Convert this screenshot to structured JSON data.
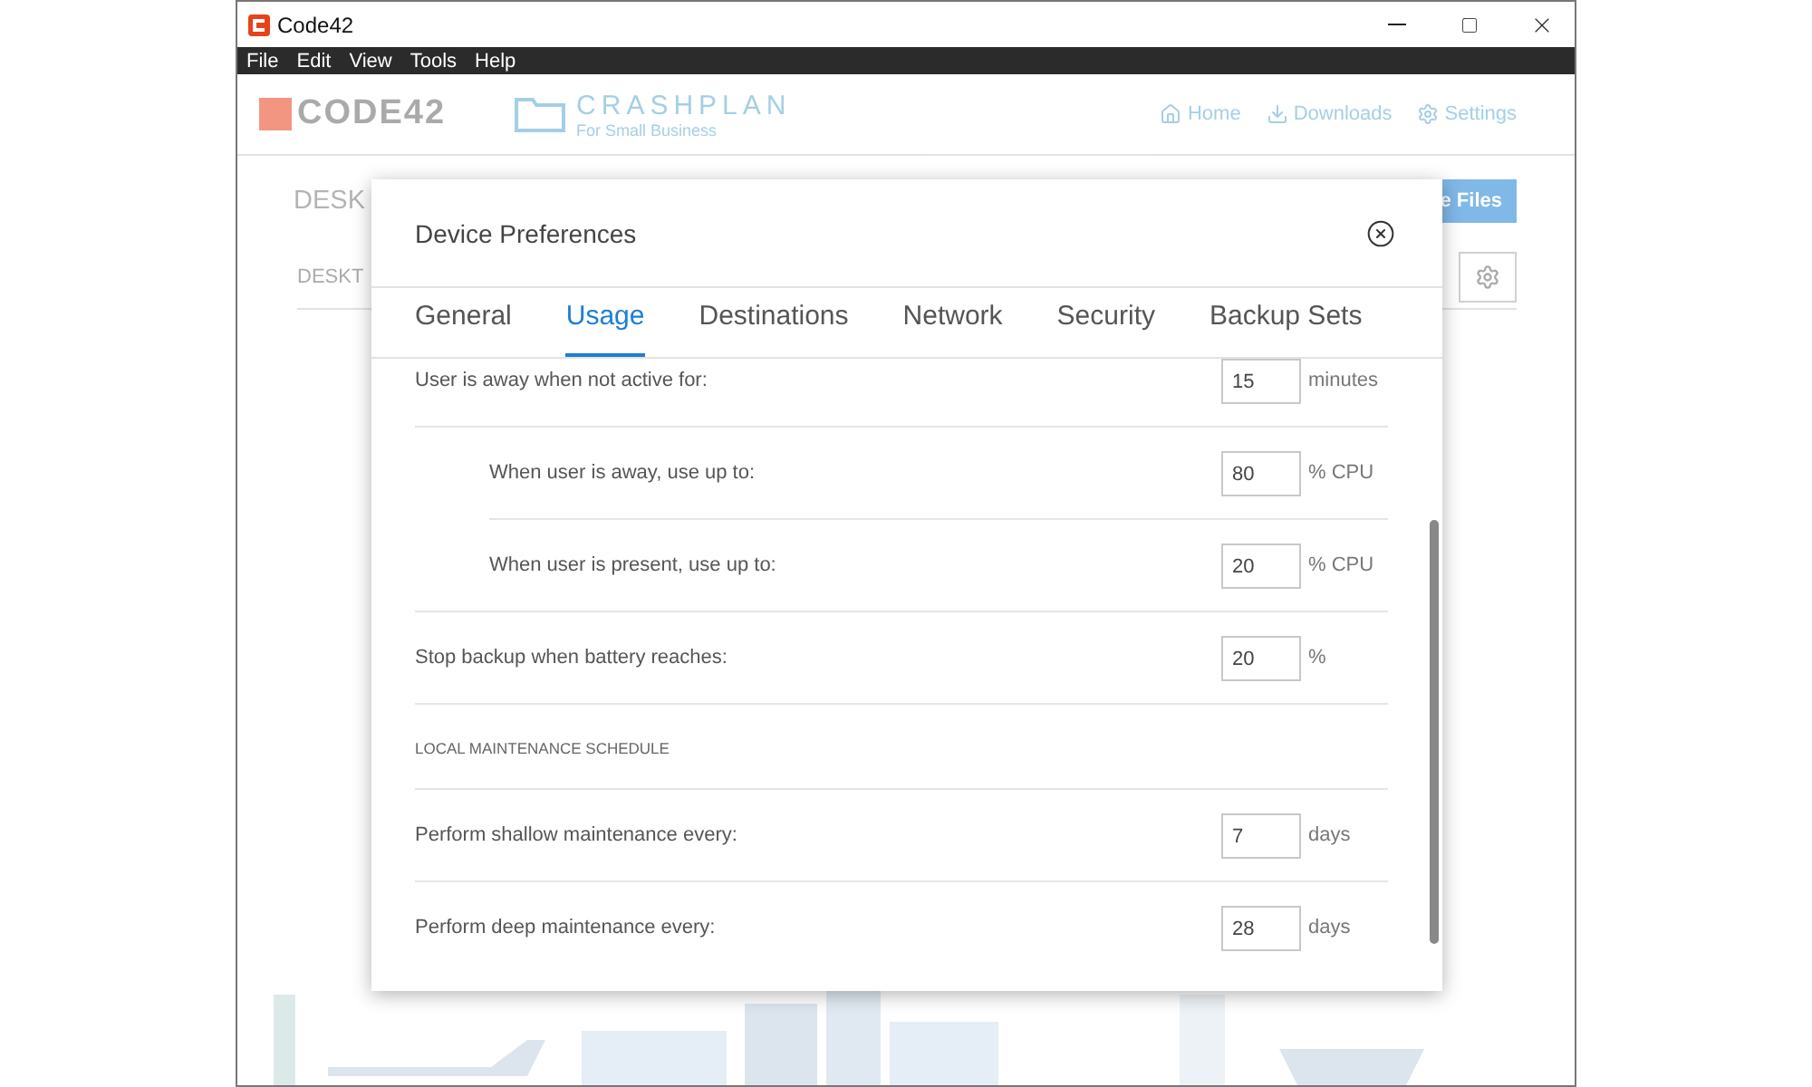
{
  "window": {
    "title": "Code42"
  },
  "menu": [
    "File",
    "Edit",
    "View",
    "Tools",
    "Help"
  ],
  "app_header": {
    "logo": "CODE42",
    "product": "CRASHPLAN",
    "product_tagline": "For Small Business",
    "nav": [
      {
        "label": "Home"
      },
      {
        "label": "Downloads"
      },
      {
        "label": "Settings"
      }
    ]
  },
  "background": {
    "heading": "DESK",
    "subheading": "DESKT",
    "button": "e Files"
  },
  "dialog": {
    "title": "Device Preferences",
    "tabs": [
      {
        "label": "General",
        "selected": false
      },
      {
        "label": "Usage",
        "selected": true
      },
      {
        "label": "Destinations",
        "selected": false
      },
      {
        "label": "Network",
        "selected": false
      },
      {
        "label": "Security",
        "selected": false
      },
      {
        "label": "Backup Sets",
        "selected": false
      }
    ],
    "rows": [
      {
        "kind": "setting",
        "label": "User is away when not active for:",
        "value": "15",
        "unit": "minutes",
        "indented": false
      },
      {
        "kind": "setting",
        "label": "When user is away, use up to:",
        "value": "80",
        "unit": "% CPU",
        "indented": true
      },
      {
        "kind": "setting",
        "label": "When user is present, use up to:",
        "value": "20",
        "unit": "% CPU",
        "indented": true
      },
      {
        "kind": "setting",
        "label": "Stop backup when battery reaches:",
        "value": "20",
        "unit": "%",
        "indented": false
      },
      {
        "kind": "heading",
        "label": "LOCAL MAINTENANCE SCHEDULE"
      },
      {
        "kind": "setting",
        "label": "Perform shallow maintenance every:",
        "value": "7",
        "unit": "days",
        "indented": false
      },
      {
        "kind": "setting",
        "label": "Perform deep maintenance every:",
        "value": "28",
        "unit": "days",
        "indented": false
      }
    ]
  }
}
